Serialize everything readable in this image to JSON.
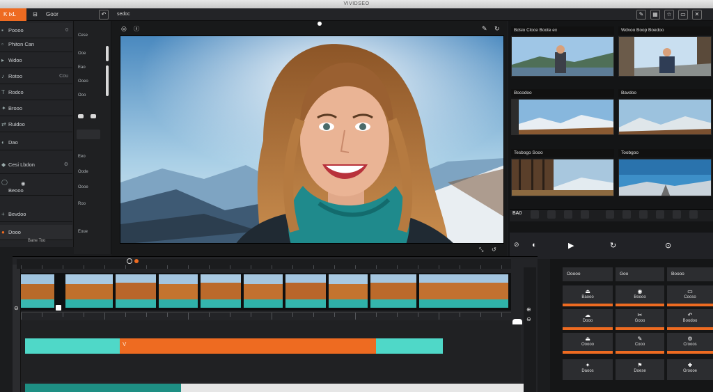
{
  "app": {
    "window_title": "VIVIDSEO",
    "logo_label": "K ixL",
    "menu_label": "Goor"
  },
  "topbar": {
    "header_tab": "sedoc",
    "icons": [
      "edit-icon",
      "grid-icon",
      "star-icon",
      "window-icon",
      "close-icon"
    ]
  },
  "left_panel": {
    "rows": [
      {
        "label": "Poooo",
        "sub": "0"
      },
      {
        "label": "Phiton Can",
        "sub": ""
      },
      {
        "label": "Wdoo",
        "sub": ""
      },
      {
        "label": "Rotoo",
        "sub": "Cou"
      },
      {
        "label": "Rodco",
        "sub": ""
      },
      {
        "label": "Brooo",
        "sub": ""
      },
      {
        "label": "Ruidoo",
        "sub": ""
      },
      {
        "label": "Dao",
        "sub": ""
      },
      {
        "label": "Cesi Lbdon",
        "sub": ""
      },
      {
        "label": "Beooo",
        "sub": ""
      },
      {
        "label": "Bevdoo",
        "sub": ""
      },
      {
        "label": "Dooo",
        "sub": ""
      }
    ],
    "footer_label": "Bane Too"
  },
  "left_strip": {
    "items": [
      "Cese",
      "Ooe",
      "Eao",
      "Ooeo",
      "Ooo",
      "Eeo",
      "Oode",
      "Oooe",
      "Roo",
      "Eoue"
    ]
  },
  "viewer": {
    "icons": [
      "camera-icon",
      "dot-icon",
      "pen-icon",
      "refresh-icon"
    ]
  },
  "thumbs": {
    "labels": [
      "Bdsio Cloce  Boote ex",
      "Wdvoo Boop  Boedoo",
      "Bocodoo",
      "Bavdoo",
      "Tesbogo  Sooo",
      "Toobgoo"
    ],
    "toolbar_label": "BA0"
  },
  "effects": {
    "headers": [
      "Ooooo",
      "Goo",
      "Boooo"
    ],
    "cells": [
      [
        "Baooo",
        "Boooo",
        "Cooso"
      ],
      [
        "Dooo",
        "Gooo",
        "Boodoo"
      ],
      [
        "Ooooo",
        "Cooo",
        "Crooos"
      ],
      [
        "Daoos",
        "Doese",
        "Groooe"
      ]
    ]
  },
  "colors": {
    "accent": "#ee6b21",
    "teal": "#4fd8c8",
    "panel": "#232427",
    "dark": "#141516"
  }
}
